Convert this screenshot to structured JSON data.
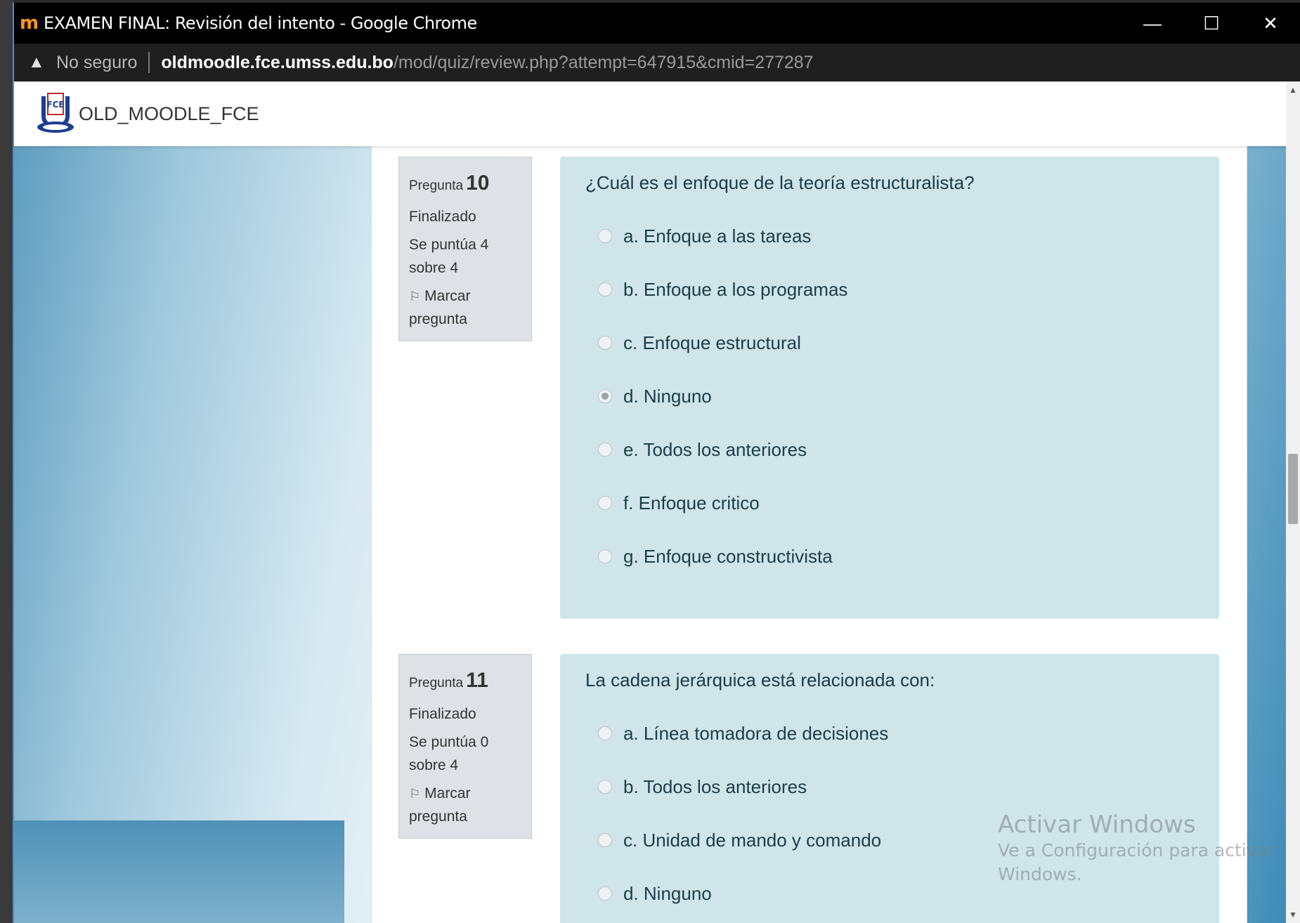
{
  "window": {
    "title": "EXAMEN FINAL: Revisión del intento - Google Chrome",
    "controls": {
      "minimize": "—",
      "maximize": "☐",
      "close": "✕"
    }
  },
  "address": {
    "security": "No seguro",
    "host": "oldmoodle.fce.umss.edu.bo",
    "path": "/mod/quiz/review.php?attempt=647915&cmid=277287"
  },
  "site": {
    "name": "OLD_MOODLE_FCE"
  },
  "questions": [
    {
      "label": "Pregunta",
      "number": "10",
      "state": "Finalizado",
      "grade_line1": "Se puntúa 4",
      "grade_line2": "sobre 4",
      "flag_line1": "Marcar",
      "flag_line2": "pregunta",
      "text": "¿Cuál es el enfoque de la teoría estructuralista?",
      "options": [
        "a. Enfoque a las tareas",
        "b. Enfoque a los programas",
        "c. Enfoque estructural",
        "d. Ninguno",
        "e. Todos los anteriores",
        "f. Enfoque critico",
        "g. Enfoque constructivista"
      ],
      "selected": "d. Ninguno"
    },
    {
      "label": "Pregunta",
      "number": "11",
      "state": "Finalizado",
      "grade_line1": "Se puntúa 0",
      "grade_line2": "sobre 4",
      "flag_line1": "Marcar",
      "flag_line2": "pregunta",
      "text": "La cadena jerárquica está relacionada con:",
      "options": [
        "a. Línea tomadora de decisiones",
        "b. Todos los anteriores",
        "c. Unidad de mando y comando",
        "d. Ninguno"
      ]
    }
  ],
  "watermark": {
    "title": "Activar Windows",
    "line1": "Ve a Configuración para activar",
    "line2": "Windows."
  }
}
